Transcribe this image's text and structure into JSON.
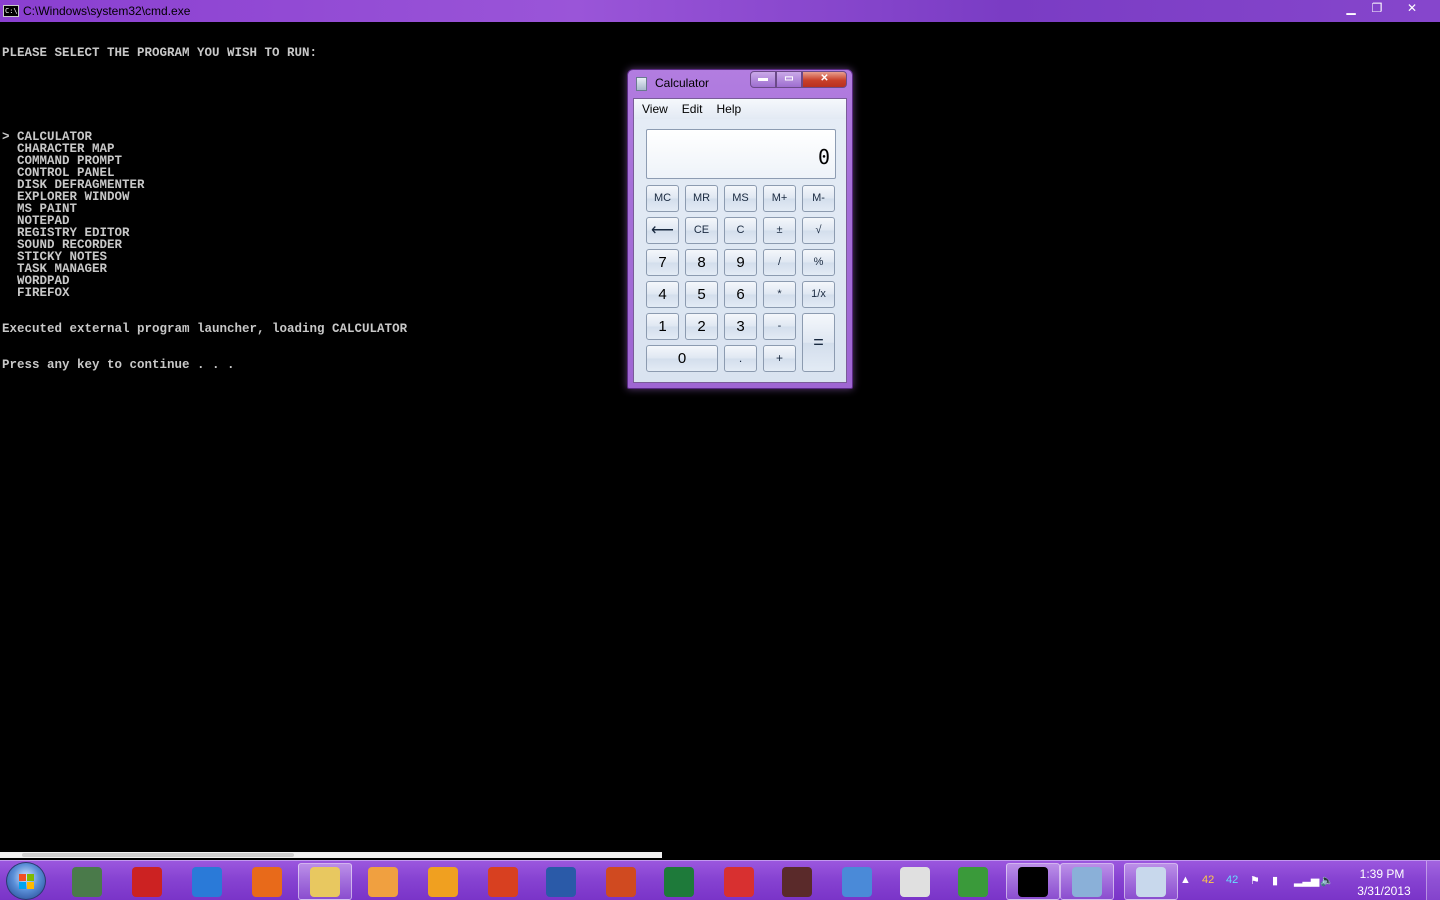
{
  "cmd_window": {
    "title": "C:\\Windows\\system32\\cmd.exe",
    "icon_text": "C:\\",
    "controls": {
      "minimize": "▁",
      "maximize": "❐",
      "close": "✕"
    }
  },
  "console": {
    "header": "PLEASE SELECT THE PROGRAM YOU WISH TO RUN:",
    "menu_lines": [
      "> CALCULATOR",
      "  CHARACTER MAP",
      "  COMMAND PROMPT",
      "  CONTROL PANEL",
      "  DISK DEFRAGMENTER",
      "  EXPLORER WINDOW",
      "  MS PAINT",
      "  NOTEPAD",
      "  REGISTRY EDITOR",
      "  SOUND RECORDER",
      "  STICKY NOTES",
      "  TASK MANAGER",
      "  WORDPAD",
      "  FIREFOX"
    ],
    "status": "Executed external program launcher, loading CALCULATOR",
    "prompt": "Press any key to continue . . ."
  },
  "calculator": {
    "title": "Calculator",
    "controls": {
      "minimize": "▬",
      "maximize": "▭",
      "close": "✕"
    },
    "menu": [
      "View",
      "Edit",
      "Help"
    ],
    "display": "0",
    "buttons": {
      "mc": "MC",
      "mr": "MR",
      "ms": "MS",
      "mplus": "M+",
      "mminus": "M-",
      "backspace": "⟵",
      "ce": "CE",
      "c": "C",
      "plusminus": "±",
      "sqrt": "√",
      "n7": "7",
      "n8": "8",
      "n9": "9",
      "div": "/",
      "pct": "%",
      "n4": "4",
      "n5": "5",
      "n6": "6",
      "mul": "*",
      "recip": "1/x",
      "n1": "1",
      "n2": "2",
      "n3": "3",
      "sub": "-",
      "eq": "=",
      "n0": "0",
      "dot": ".",
      "add": "+"
    }
  },
  "taskbar": {
    "items": [
      {
        "name": "system-monitor",
        "color": "#4a7a4a"
      },
      {
        "name": "media-tool",
        "color": "#cc2222"
      },
      {
        "name": "internet-explorer",
        "color": "#2a7ad8"
      },
      {
        "name": "firefox",
        "color": "#e86a1a"
      },
      {
        "name": "windows-explorer",
        "color": "#e8c860"
      },
      {
        "name": "media-player",
        "color": "#f0a040"
      },
      {
        "name": "join-me",
        "color": "#f0a020"
      },
      {
        "name": "office",
        "color": "#d84020"
      },
      {
        "name": "word",
        "color": "#2a5aa8"
      },
      {
        "name": "powerpoint",
        "color": "#d04a20"
      },
      {
        "name": "excel",
        "color": "#1e7a3a"
      },
      {
        "name": "audio-app",
        "color": "#d83030"
      },
      {
        "name": "video-app",
        "color": "#5a2a2a"
      },
      {
        "name": "user-app",
        "color": "#4a8ad8"
      },
      {
        "name": "solitaire",
        "color": "#e0e0e0"
      },
      {
        "name": "chrome",
        "color": "#3a9a3a"
      },
      {
        "name": "cmd",
        "color": "#000000"
      },
      {
        "name": "paint",
        "color": "#8ab0d8"
      },
      {
        "name": "calculator",
        "color": "#c8d8ec"
      }
    ],
    "tray": {
      "num1": "42",
      "num2": "42",
      "time": "1:39 PM",
      "date": "3/31/2013"
    }
  }
}
